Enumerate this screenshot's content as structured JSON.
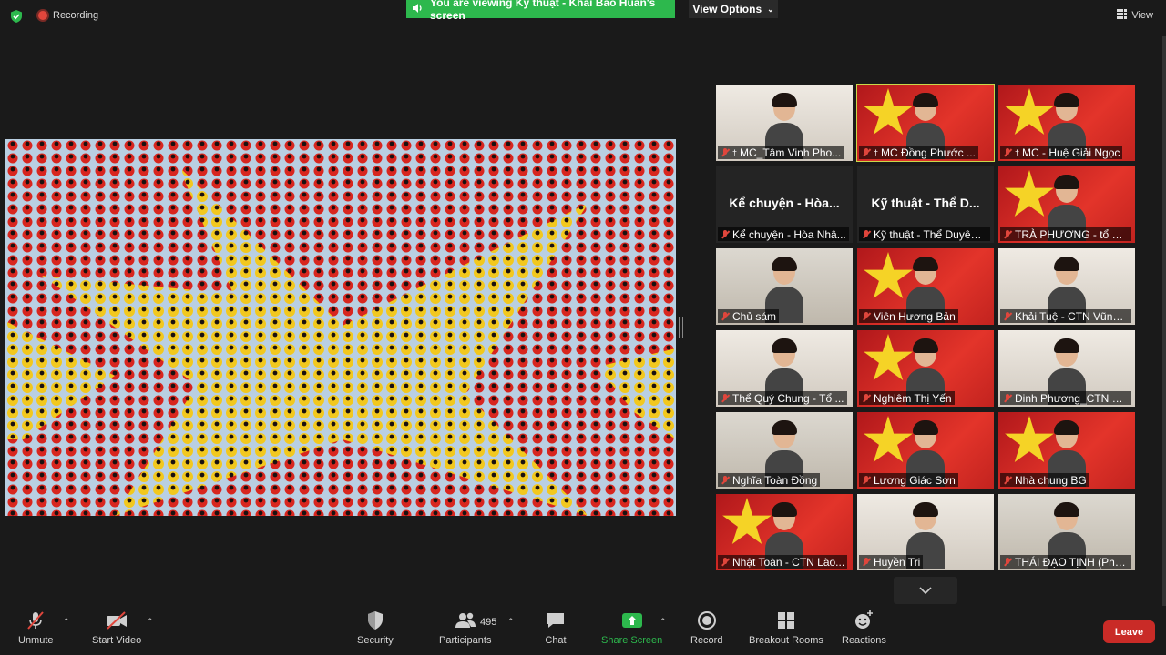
{
  "status": {
    "recording_label": "Recording"
  },
  "banner": {
    "viewing_text": "You are viewing Kỹ thuật - Khải Bảo Huấn's screen",
    "view_options_label": "View Options"
  },
  "top_right": {
    "view_label": "View"
  },
  "gallery": [
    {
      "name": "MC_Tâm Vinh Pho...",
      "pinned": true,
      "style": "wall"
    },
    {
      "name": "MC Đồng Phước ...",
      "pinned": true,
      "style": "flag",
      "active": true
    },
    {
      "name": "MC - Huệ Giải Ngọc",
      "pinned": true,
      "style": "flag"
    },
    {
      "name": "Kể chuyện - Hòa Nhâ...",
      "big": "Kể chuyện - Hòa...",
      "style": "none"
    },
    {
      "name": "Kỹ thuật - Thể Duyên ...",
      "big": "Kỹ thuật - Thể D...",
      "style": "none"
    },
    {
      "name": "TRÀ PHƯƠNG - tổ 1 ...",
      "style": "flag"
    },
    {
      "name": "Chủ sám",
      "style": "room"
    },
    {
      "name": "Viên Hương Bản",
      "style": "flag"
    },
    {
      "name": "Khải Tuệ - CTN Vũng ...",
      "style": "wall"
    },
    {
      "name": "Thể Quý Chung - Tổ ...",
      "style": "wall"
    },
    {
      "name": "Nghiêm Thị Yến",
      "style": "flag"
    },
    {
      "name": "Đinh Phương_CTN H...",
      "style": "wall"
    },
    {
      "name": "Nghĩa Toàn Đồng",
      "style": "room"
    },
    {
      "name": "Lương Giác Sơn",
      "style": "flag"
    },
    {
      "name": "Nhà chung BG",
      "style": "flag"
    },
    {
      "name": "Nhật Toàn - CTN Lào...",
      "style": "flag"
    },
    {
      "name": "Huyền Tri",
      "style": "wall"
    },
    {
      "name": "THÁI ĐẠO TỊNH (Phật...",
      "style": "room"
    }
  ],
  "toolbar": {
    "unmute": "Unmute",
    "start_video": "Start Video",
    "security": "Security",
    "participants": "Participants",
    "participants_count": "495",
    "chat": "Chat",
    "share_screen": "Share Screen",
    "record": "Record",
    "breakout_rooms": "Breakout Rooms",
    "reactions": "Reactions",
    "leave": "Leave"
  },
  "colors": {
    "share_green": "#2db84d",
    "leave_red": "#c92b27",
    "active_speaker": "#c9d84a",
    "muted_red": "#e0463c"
  }
}
